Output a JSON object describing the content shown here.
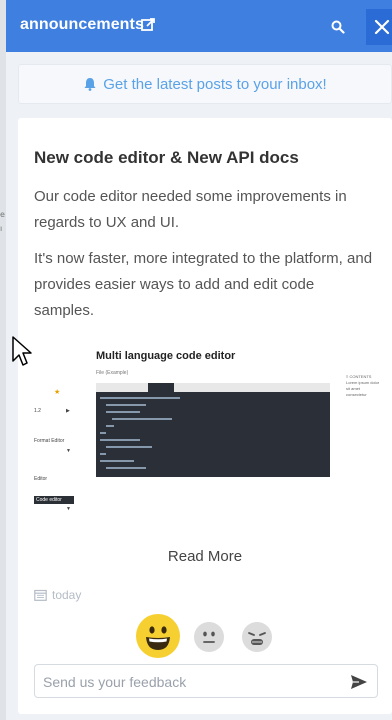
{
  "header": {
    "title": "announcements",
    "edit_icon": "external-edit-icon",
    "search_icon": "search-icon",
    "close_icon": "close-icon",
    "color": "#3f7fe0"
  },
  "subscribe": {
    "label": "Get the latest posts to your inbox!",
    "icon": "bell-icon"
  },
  "post": {
    "title": "New code editor & New API docs",
    "paragraphs": [
      "Our code editor needed some improvements in regards to UX and UI.",
      "It's now faster, more integrated to the platform, and provides easier ways to add and edit code samples."
    ],
    "image": {
      "title": "Multi language code editor",
      "chip_text": "Code editor"
    },
    "read_more": "Read More",
    "date": "today"
  },
  "reactions": [
    "happy-face-icon",
    "neutral-face-icon",
    "sad-face-icon"
  ],
  "feedback": {
    "placeholder": "Send us your feedback",
    "value": ""
  }
}
